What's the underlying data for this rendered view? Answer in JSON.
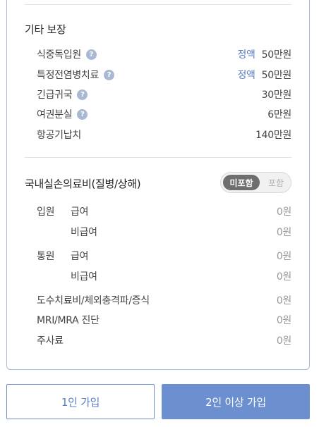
{
  "other_coverage": {
    "title": "기타 보장",
    "items": [
      {
        "label": "식중독입원",
        "help": true,
        "tag": "정액",
        "amount": "50만원"
      },
      {
        "label": "특정전염병치료",
        "help": true,
        "tag": "정액",
        "amount": "50만원"
      },
      {
        "label": "긴급귀국",
        "help": true,
        "tag": "",
        "amount": "30만원"
      },
      {
        "label": "여권분실",
        "help": true,
        "tag": "",
        "amount": "6만원"
      },
      {
        "label": "항공기납치",
        "help": false,
        "tag": "",
        "amount": "140만원"
      }
    ]
  },
  "domestic": {
    "title": "국내실손의료비(질병/상해)",
    "toggle": {
      "selected": "미포함",
      "other": "포함"
    },
    "inpatient": {
      "group": "입원",
      "covered": "급여",
      "covered_amt": "0원",
      "noncovered": "비급여",
      "noncovered_amt": "0원"
    },
    "outpatient": {
      "group": "통원",
      "covered": "급여",
      "covered_amt": "0원",
      "noncovered": "비급여",
      "noncovered_amt": "0원"
    },
    "others": [
      {
        "label": "도수치료비/체외충격파/증식",
        "amount": "0원"
      },
      {
        "label": "MRI/MRA 진단",
        "amount": "0원"
      },
      {
        "label": "주사료",
        "amount": "0원"
      }
    ]
  },
  "buttons": {
    "one_person": "1인 가입",
    "two_plus": "2인 이상 가입"
  },
  "help_glyph": "?",
  "colors": {
    "accent": "#5a7fc4",
    "button_fill": "#6c90cf",
    "toggle_on": "#6e6e6e"
  }
}
